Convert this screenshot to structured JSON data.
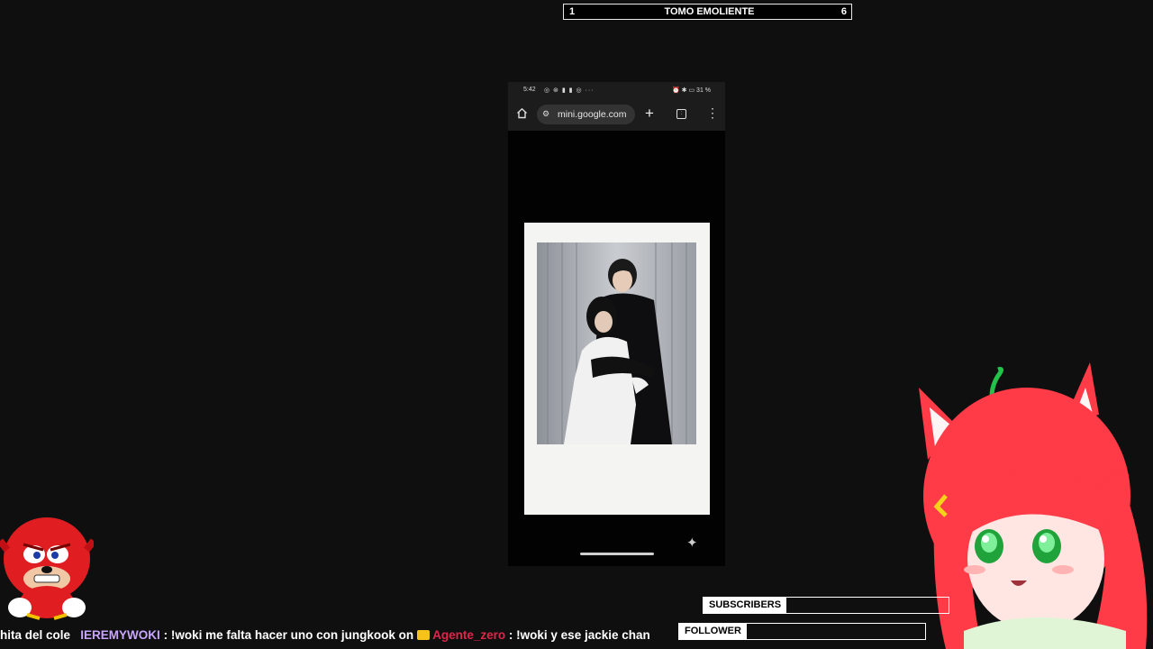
{
  "top_counter": {
    "left": "1",
    "title": "TOMO EMOLIENTE",
    "right": "6"
  },
  "phone": {
    "status_time": "5:42",
    "status_icons": "◎ ⊛ ▮ ▮ ◎ ···",
    "status_right": "⏰ ✱ ▭ 31 %",
    "url": "mini.google.com"
  },
  "overlay": {
    "subscribers_label": "SUBSCRIBERS",
    "follower_label": "FOLLOWER"
  },
  "chat_ticker": {
    "prefix": "hita del cole",
    "user1": "IEREMYWOKI",
    "msg1": ": !woki me falta hacer uno con jungkook on",
    "user2": "Agente_zero",
    "msg2": ": !woki y ese jackie chan"
  },
  "colors": {
    "accent_user1": "#c8a6ff",
    "accent_user2": "#e0244a",
    "avatar_hair": "#ff3b47"
  }
}
